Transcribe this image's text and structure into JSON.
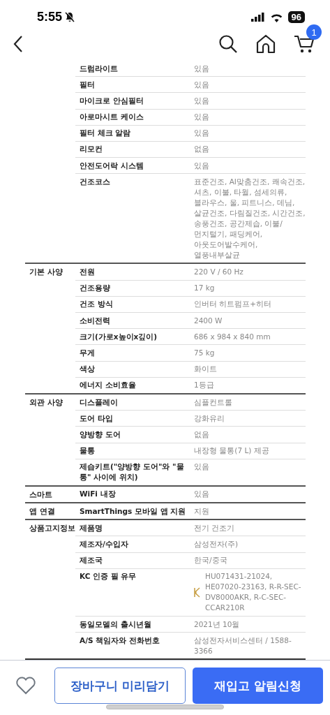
{
  "status_bar": {
    "time": "5:55",
    "battery": "96"
  },
  "nav": {
    "cart_count": "1"
  },
  "spec_groups": [
    {
      "rows": [
        {
          "kind": "text",
          "label": "드럼라이트",
          "value": "있음"
        },
        {
          "kind": "text",
          "label": "필터",
          "value": "있음"
        },
        {
          "kind": "text",
          "label": "마이크로 안심필터",
          "value": "있음"
        },
        {
          "kind": "text",
          "label": "아로마시트 케이스",
          "value": "있음"
        },
        {
          "kind": "text",
          "label": "필터 체크 알람",
          "value": "있음"
        },
        {
          "kind": "text",
          "label": "리모컨",
          "value": "없음"
        },
        {
          "kind": "text",
          "label": "안전도어락 시스템",
          "value": "있음"
        },
        {
          "kind": "text",
          "label": "건조코스",
          "value": "표준건조, AI맞춤건조, 쾌속건조, 셔츠, 이불, 타월, 섬세의류, 블라우스, 울, 피트니스, 데님, 살균건조, 다림질건조, 시간건조, 송풍건조, 공간제습, 이불/먼지털기, 패딩케어, 아웃도어발수케어, 열풍내부살균"
        }
      ]
    },
    {
      "name": "기본 사양",
      "rows": [
        {
          "kind": "text",
          "label": "전원",
          "value": "220 V / 60 Hz"
        },
        {
          "kind": "text",
          "label": "건조용량",
          "value": "17 kg"
        },
        {
          "kind": "text",
          "label": "건조 방식",
          "value": "인버터 히트펌프+히터"
        },
        {
          "kind": "text",
          "label": "소비전력",
          "value": "2400 W"
        },
        {
          "kind": "text",
          "label": "크기(가로x높이x깊이)",
          "value": "686 x 984 x 840 mm"
        },
        {
          "kind": "text",
          "label": "무게",
          "value": "75 kg"
        },
        {
          "kind": "text",
          "label": "색상",
          "value": "화이트"
        },
        {
          "kind": "text",
          "label": "에너지 소비효율",
          "value": "1등급"
        }
      ]
    },
    {
      "name": "외관 사양",
      "rows": [
        {
          "kind": "text",
          "label": "디스플레이",
          "value": "심플컨트롤"
        },
        {
          "kind": "text",
          "label": "도어 타입",
          "value": "강화유리"
        },
        {
          "kind": "text",
          "label": "양방향 도어",
          "value": "없음"
        },
        {
          "kind": "text",
          "label": "물통",
          "value": "내장형 물통(7 L) 제공"
        },
        {
          "kind": "text",
          "label": "제습키트(\"양방향 도어\"와 \"물통\" 사이에 위치)",
          "value": "있음"
        }
      ]
    },
    {
      "name": "스마트",
      "rows": [
        {
          "kind": "text",
          "label": "WiFi 내장",
          "value": "있음"
        }
      ]
    },
    {
      "name": "앱 연결",
      "rows": [
        {
          "kind": "text",
          "label": "SmartThings 모바일 앱 지원",
          "value": "지원"
        }
      ]
    },
    {
      "name": "상품고지정보",
      "rows": [
        {
          "kind": "text",
          "label": "제품명",
          "value": "전기 건조기"
        },
        {
          "kind": "text",
          "label": "제조자/수입자",
          "value": "삼성전자(주)"
        },
        {
          "kind": "text",
          "label": "제조국",
          "value": "한국/중국"
        },
        {
          "kind": "kc",
          "label": "KC 인증 필 유무",
          "value": "HU071431-21024, HE07020-23163, R-R-SEC-DV8000AKR, R-C-SEC-CCAR210R"
        },
        {
          "kind": "text",
          "label": "동일모델의 출시년월",
          "value": "2021년 10월"
        },
        {
          "kind": "text",
          "label": "A/S 책임자와 전화번호",
          "value": "삼성전자서비스센터 / 1588-3366"
        }
      ]
    }
  ],
  "actions": {
    "cart_button": "장바구니 미리담기",
    "restock_button": "재입고 알림신청"
  }
}
